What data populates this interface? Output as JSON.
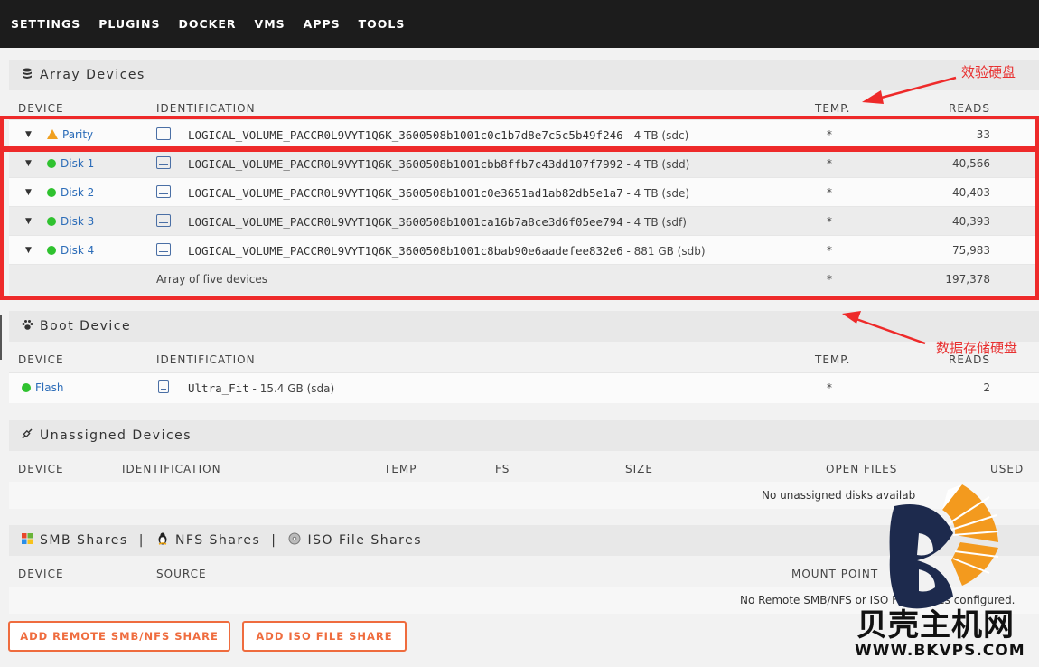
{
  "nav": [
    "SETTINGS",
    "PLUGINS",
    "DOCKER",
    "VMS",
    "APPS",
    "TOOLS"
  ],
  "array": {
    "title": "Array Devices",
    "headers": {
      "device": "DEVICE",
      "identification": "IDENTIFICATION",
      "temp": "TEMP.",
      "reads": "READS"
    },
    "rows": [
      {
        "device": "Parity",
        "status": "warning",
        "id": "LOGICAL_VOLUME_PACCR0L9VYT1Q6K_3600508b1001c0c1b7d8e7c5c5b49f246",
        "size": " - 4 TB (sdc)",
        "temp": "*",
        "reads": "33"
      },
      {
        "device": "Disk 1",
        "status": "ok",
        "id": "LOGICAL_VOLUME_PACCR0L9VYT1Q6K_3600508b1001cbb8ffb7c43dd107f7992",
        "size": " - 4 TB (sdd)",
        "temp": "*",
        "reads": "40,566"
      },
      {
        "device": "Disk 2",
        "status": "ok",
        "id": "LOGICAL_VOLUME_PACCR0L9VYT1Q6K_3600508b1001c0e3651ad1ab82db5e1a7",
        "size": " - 4 TB (sde)",
        "temp": "*",
        "reads": "40,403"
      },
      {
        "device": "Disk 3",
        "status": "ok",
        "id": "LOGICAL_VOLUME_PACCR0L9VYT1Q6K_3600508b1001ca16b7a8ce3d6f05ee794",
        "size": " - 4 TB (sdf)",
        "temp": "*",
        "reads": "40,393"
      },
      {
        "device": "Disk 4",
        "status": "ok",
        "id": "LOGICAL_VOLUME_PACCR0L9VYT1Q6K_3600508b1001c8bab90e6aadefee832e6",
        "size": " - 881 GB (sdb)",
        "temp": "*",
        "reads": "75,983"
      }
    ],
    "summary": {
      "label": "Array of five devices",
      "temp": "*",
      "reads": "197,378"
    }
  },
  "boot": {
    "title": "Boot Device",
    "headers": {
      "device": "DEVICE",
      "identification": "IDENTIFICATION",
      "temp": "TEMP.",
      "reads": "READS"
    },
    "row": {
      "device": "Flash",
      "id": "Ultra_Fit",
      "size": " - 15.4 GB (sda)",
      "temp": "*",
      "reads": "2"
    }
  },
  "unassigned": {
    "title": "Unassigned Devices",
    "headers": {
      "device": "DEVICE",
      "identification": "IDENTIFICATION",
      "temp": "TEMP",
      "fs": "FS",
      "size": "SIZE",
      "open_files": "OPEN FILES",
      "used": "USED"
    },
    "empty": "No unassigned disks availab"
  },
  "shares": {
    "tabs": [
      "SMB Shares",
      "NFS Shares",
      "ISO File Shares"
    ],
    "separator": "|",
    "headers": {
      "device": "DEVICE",
      "source": "SOURCE",
      "mount": "MOUNT POINT"
    },
    "empty": "No Remote SMB/NFS or ISO File Shares configured."
  },
  "buttons": {
    "add_remote": "ADD REMOTE SMB/NFS SHARE",
    "add_iso": "ADD ISO FILE SHARE"
  },
  "annotations": {
    "parity_note": "效验硬盘",
    "data_note": "数据存储硬盘"
  },
  "watermark": {
    "brand": "贝壳主机网",
    "url": "WWW.BKVPS.COM"
  },
  "colors": {
    "accent": "#ef6c3e",
    "ok": "#2fc22f",
    "warning": "#f0a020",
    "link": "#2b6cb8",
    "annotation": "#ee2a2a"
  },
  "icons": {
    "array": "database-icon",
    "boot": "paw-icon",
    "unassigned": "plug-icon",
    "smb": "windows-icon",
    "nfs": "linux-icon",
    "iso": "disc-icon",
    "disk": "hard-drive-icon",
    "flash": "usb-icon"
  }
}
